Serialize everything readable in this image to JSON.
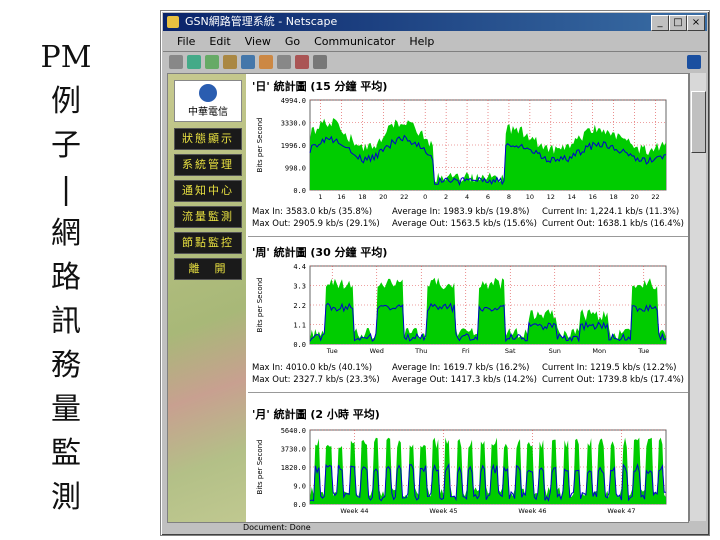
{
  "slide": {
    "title_chars": [
      "PM",
      "例",
      "子",
      "|",
      "網",
      "路",
      "訊",
      "務",
      "量",
      "監",
      "測"
    ]
  },
  "browser": {
    "title": "GSN網路管理系統 - Netscape",
    "menu": [
      "File",
      "Edit",
      "View",
      "Go",
      "Communicator",
      "Help"
    ],
    "status": "Document: Done",
    "window_buttons": [
      "_",
      "□",
      "×"
    ]
  },
  "sidebar": {
    "logo_text": "中華電信",
    "items": [
      {
        "label": "狀態顯示"
      },
      {
        "label": "系統管理"
      },
      {
        "label": "通知中心"
      },
      {
        "label": "流量監測"
      },
      {
        "label": "節點監控"
      },
      {
        "label": "離　開"
      }
    ]
  },
  "graphs": [
    {
      "title": "'日' 統計圖 (15 分鐘 平均)",
      "ylabel": "Bits per Second",
      "yticks": [
        "4994.0",
        "3330.0",
        "1996.0",
        "998.0",
        "0.0"
      ],
      "xticks": [
        "1",
        "16",
        "18",
        "20",
        "22",
        "0",
        "2",
        "4",
        "6",
        "8",
        "10",
        "12",
        "14",
        "16",
        "18",
        "20",
        "22"
      ],
      "stats": {
        "max_in": "Max In: 3583.0 kb/s (35.8%)",
        "avg_in": "Average In: 1983.9 kb/s (19.8%)",
        "cur_in": "Current In: 1,224.1 kb/s (11.3%)",
        "max_out": "Max Out: 2905.9 kb/s (29.1%)",
        "avg_out": "Average Out: 1563.5 kb/s (15.6%)",
        "cur_out": "Current Out: 1638.1 kb/s (16.4%)"
      }
    },
    {
      "title": "'周' 統計圖 (30 分鐘 平均)",
      "ylabel": "Bits per Second",
      "yticks": [
        "4.4",
        "3.3",
        "2.2",
        "1.1",
        "0.0"
      ],
      "xticks": [
        "Tue",
        "Wed",
        "Thu",
        "Fri",
        "Sat",
        "Sun",
        "Mon",
        "Tue"
      ],
      "stats": {
        "max_in": "Max In: 4010.0 kb/s (40.1%)",
        "avg_in": "Average In: 1619.7 kb/s (16.2%)",
        "cur_in": "Current In: 1219.5 kb/s (12.2%)",
        "max_out": "Max Out: 2327.7 kb/s (23.3%)",
        "avg_out": "Average Out: 1417.3 kb/s (14.2%)",
        "cur_out": "Current Out: 1739.8 kb/s (17.4%)"
      }
    },
    {
      "title": "'月' 統計圖 (2 小時 平均)",
      "ylabel": "Bits per Second",
      "yticks": [
        "5640.0",
        "3730.0",
        "1820.0",
        "9.0",
        "0.0"
      ],
      "xticks": [
        "Week 44",
        "Week 45",
        "Week 46",
        "Week 47"
      ],
      "stats": null
    }
  ],
  "colors": {
    "in_fill": "#00cc00",
    "out_line": "#0000cc",
    "accent": "#e8e040"
  }
}
